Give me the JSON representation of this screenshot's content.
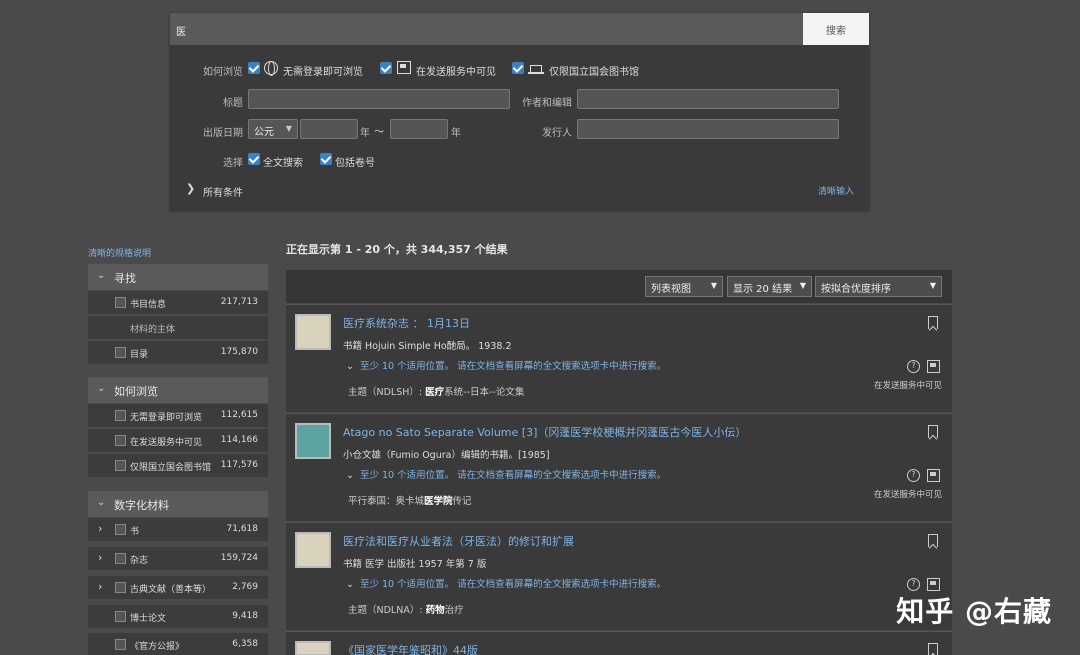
{
  "search": {
    "query": "医",
    "button": "搜索",
    "browse_label": "如何浏览",
    "browse_options": [
      "无需登录即可浏览",
      "在发送服务中可见",
      "仅限国立国会图书馆"
    ],
    "title_label": "标题",
    "author_label": "作者和编辑",
    "date_label": "出版日期",
    "era": "公元",
    "year_suffix": "年",
    "tilde": "〜",
    "publisher_label": "发行人",
    "select_label": "选择",
    "fulltext": "全文搜索",
    "volume": "包括卷号",
    "all_conditions": "所有条件",
    "clear": "清晰输入"
  },
  "results_summary": "正在显示第 1 - 20 个，共 344,357 个结果",
  "sidebar": {
    "help_link": "清晰的规格说明",
    "groups": [
      {
        "title": "寻找",
        "items": [
          {
            "name": "书目信息",
            "count": "217,713",
            "checkbox": true
          },
          {
            "name": "材料的主体",
            "count": "",
            "checkbox": false
          },
          {
            "name": "目录",
            "count": "175,870",
            "checkbox": true
          }
        ]
      },
      {
        "title": "如何浏览",
        "items": [
          {
            "name": "无需登录即可浏览",
            "count": "112,615",
            "checkbox": true
          },
          {
            "name": "在发送服务中可见",
            "count": "114,166",
            "checkbox": true
          },
          {
            "name": "仅限国立国会图书馆",
            "count": "117,576",
            "checkbox": true
          }
        ]
      },
      {
        "title": "数字化材料",
        "items": [
          {
            "name": "书",
            "count": "71,618",
            "checkbox": true,
            "expand": true
          },
          {
            "name": "杂志",
            "count": "159,724",
            "checkbox": true,
            "expand": true
          },
          {
            "name": "古典文献（善本等）",
            "count": "2,769",
            "checkbox": true,
            "expand": true
          },
          {
            "name": "博士论文",
            "count": "9,418",
            "checkbox": true
          },
          {
            "name": "《官方公报》",
            "count": "6,358",
            "checkbox": true
          }
        ]
      }
    ]
  },
  "toolbar": {
    "view": "列表视图",
    "per_page": "显示 20 结果",
    "sort": "按拟合优度排序"
  },
  "results": [
    {
      "title": "医疗系统杂志 ： 1月13日",
      "meta": "书籍 Hojuin Simple Ho酏局。 1938.2",
      "snippet": "至少 10 个适用位置。 请在文档查看屏幕的全文搜索选项卡中进行搜索。",
      "subject_prefix": "主题（NDLSH）:",
      "subject_bold": "医疗",
      "subject_rest": "系统--日本--论文集",
      "avail": "在发送服务中可见"
    },
    {
      "title": "Atago no Sato Separate Volume [3]（冈蓬医学校梗概并冈蓬医古今医人小伝）",
      "meta": "小仓文雄（Fumio Ogura）编辑的书籍。[1985]",
      "snippet": "至少 10 个适用位置。 请在文档查看屏幕的全文搜索选项卡中进行搜索。",
      "subject_prefix": "平行泰国：奥卡城",
      "subject_bold": "医学院",
      "subject_rest": "传记",
      "avail": "在发送服务中可见"
    },
    {
      "title": "医疗法和医疗从业者法（牙医法）的修订和扩展",
      "meta": "书籍 医学 出版社 1957 年第 7 版",
      "snippet": "至少 10 个适用位置。 请在文档查看屏幕的全文搜索选项卡中进行搜索。",
      "subject_prefix": "主题（NDLNA）:",
      "subject_bold": "药物",
      "subject_rest": "治疗",
      "avail": ""
    },
    {
      "title": "《国家医学年鉴昭和》44版",
      "meta": "",
      "snippet": "",
      "subject_prefix": "",
      "subject_bold": "",
      "subject_rest": "",
      "avail": ""
    }
  ],
  "watermark": "知乎 @右藏"
}
